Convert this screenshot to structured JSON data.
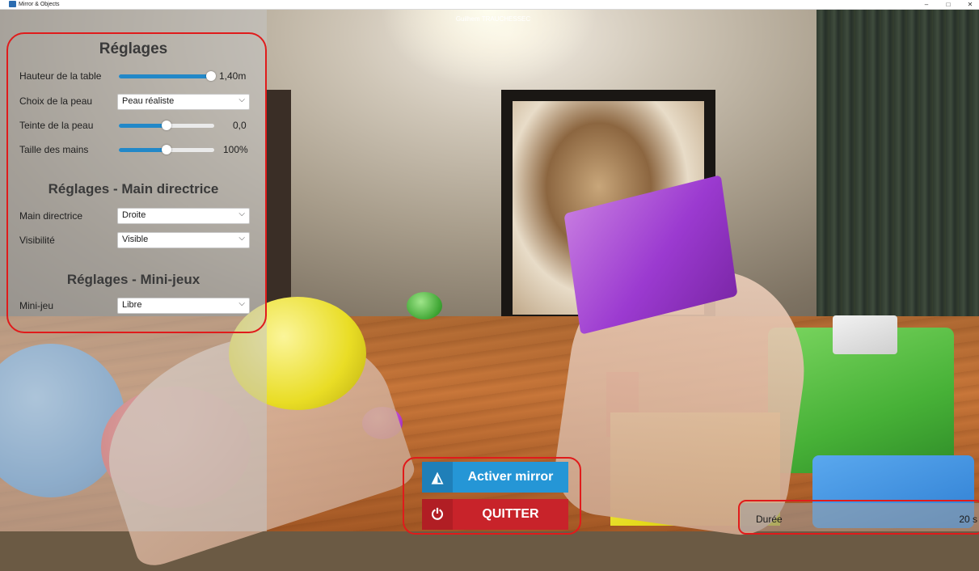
{
  "window": {
    "title": "Mirror & Objects",
    "controls": {
      "minimize": "–",
      "maximize": "□",
      "close": "✕"
    }
  },
  "user": {
    "name": "Guilhem TRAUCHESSEC"
  },
  "settings": {
    "title": "Réglages",
    "table_height": {
      "label": "Hauteur de la table",
      "value": "1,40m",
      "level": 0.97
    },
    "skin_choice": {
      "label": "Choix de la peau",
      "value": "Peau réaliste"
    },
    "skin_tint": {
      "label": "Teinte de la peau",
      "value": "0,0",
      "level": 0.5
    },
    "hand_size": {
      "label": "Taille des mains",
      "value": "100%",
      "level": 0.5
    }
  },
  "dominant_hand": {
    "title": "Réglages - Main directrice",
    "hand": {
      "label": "Main directrice",
      "value": "Droite"
    },
    "visibility": {
      "label": "Visibilité",
      "value": "Visible"
    }
  },
  "minigames": {
    "title": "Réglages - Mini-jeux",
    "minigame": {
      "label": "Mini-jeu",
      "value": "Libre"
    }
  },
  "buttons": {
    "mirror": {
      "label": "Activer mirror",
      "icon": "mirror-icon"
    },
    "quit": {
      "label": "QUITTER",
      "icon": "power-icon"
    }
  },
  "duration": {
    "label": "Durée",
    "value": "20 s"
  },
  "colors": {
    "accent_blue": "#2596d6",
    "quit_red": "#c8232a",
    "highlight_red": "#e01b1b",
    "slider_fill": "#2288c8"
  }
}
